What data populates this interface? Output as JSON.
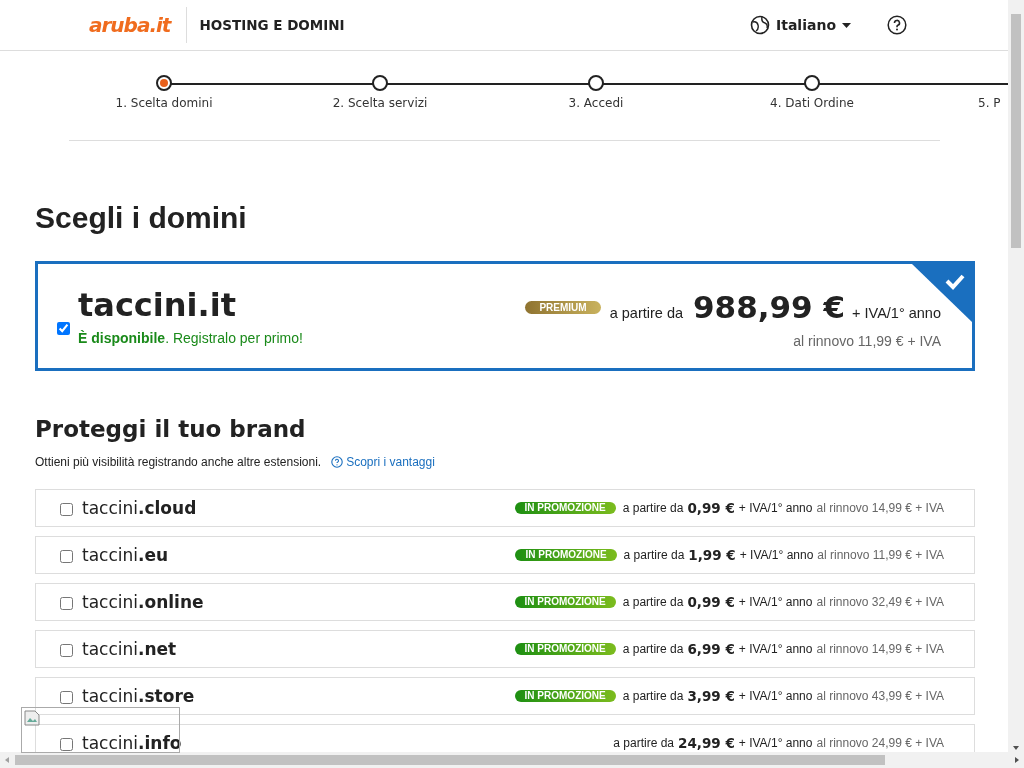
{
  "header": {
    "logo": "aruba.it",
    "section": "HOSTING E DOMINI",
    "language": "Italiano"
  },
  "steps": [
    {
      "label": "1. Scelta domini",
      "selected": true
    },
    {
      "label": "2. Scelta servizi",
      "selected": false
    },
    {
      "label": "3. Accedi",
      "selected": false
    },
    {
      "label": "4. Dati Ordine",
      "selected": false
    },
    {
      "label": "5. P"
    }
  ],
  "title": "Scegli i domini",
  "main_domain": {
    "name": "taccini.it",
    "checked": true,
    "availability": "**È disponibile**. Registralo per primo!",
    "badge": "PREMIUM",
    "price_prefix": "a partire da",
    "price": "988,99 €",
    "price_suffix": "+ IVA/1° anno",
    "renewal": "al rinnovo 11,99 € + IVA"
  },
  "brand": {
    "title": "Proteggi il tuo brand",
    "text": "Ottieni più visibilità registrando anche altre estensioni.",
    "link": "Scopri i vantaggi"
  },
  "extensions": [
    {
      "base": "taccini",
      "ext": ".cloud",
      "checked": false,
      "badge": "IN PROMOZIONE",
      "price_prefix": "a partire da",
      "price": "0,99 €",
      "price_suffix": "+ IVA/1° anno",
      "renewal": "al rinnovo 14,99 € + IVA"
    },
    {
      "base": "taccini",
      "ext": ".eu",
      "checked": false,
      "badge": "IN PROMOZIONE",
      "price_prefix": "a partire da",
      "price": "1,99 €",
      "price_suffix": "+ IVA/1° anno",
      "renewal": "al rinnovo 11,99 € + IVA"
    },
    {
      "base": "taccini",
      "ext": ".online",
      "checked": false,
      "badge": "IN PROMOZIONE",
      "price_prefix": "a partire da",
      "price": "0,99 €",
      "price_suffix": "+ IVA/1° anno",
      "renewal": "al rinnovo 32,49 € + IVA"
    },
    {
      "base": "taccini",
      "ext": ".net",
      "checked": false,
      "badge": "IN PROMOZIONE",
      "price_prefix": "a partire da",
      "price": "6,99 €",
      "price_suffix": "+ IVA/1° anno",
      "renewal": "al rinnovo 14,99 € + IVA"
    },
    {
      "base": "taccini",
      "ext": ".store",
      "checked": false,
      "badge": "IN PROMOZIONE",
      "price_prefix": "a partire da",
      "price": "3,99 €",
      "price_suffix": "+ IVA/1° anno",
      "renewal": "al rinnovo 43,99 € + IVA"
    },
    {
      "base": "taccini",
      "ext": ".info",
      "checked": false,
      "price_prefix": "a partire da",
      "price": "24,99 €",
      "price_suffix": "+ IVA/1° anno",
      "renewal": "al rinnovo 24,99 € + IVA"
    }
  ]
}
